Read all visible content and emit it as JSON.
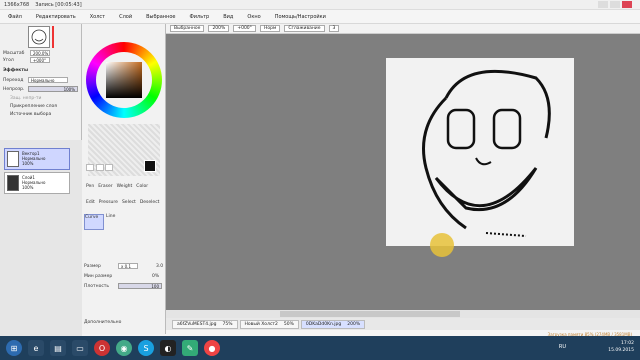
{
  "titlebar": {
    "resolution": "1366x768",
    "recording": "Запись [00:05:43]"
  },
  "menu": [
    "Файл",
    "Редактировать",
    "Холст",
    "Слой",
    "Выбранное",
    "Фильтр",
    "Вид",
    "Окно",
    "Помощь/Настройки"
  ],
  "navigator": {
    "zoom_label": "Масштаб",
    "zoom_value": "200.0%",
    "angle_label": "Угол",
    "angle_value": "+000°",
    "effects_label": "Эффекты",
    "blend_label": "Переход",
    "blend_value": "Нормально",
    "opacity_label": "Непрозр.",
    "opacity_value": "100%",
    "protect_alpha": "Защ. непр-ти",
    "clip_layer": "Прикрепление слоя",
    "selection_source": "Источник выбора"
  },
  "layers": [
    {
      "name": "Вектор1",
      "mode": "Нормально",
      "opacity": "100%"
    },
    {
      "name": "Слой1",
      "mode": "Нормально",
      "opacity": "100%"
    }
  ],
  "tools": {
    "row1": [
      "Pen",
      "Eraser",
      "Weight",
      "Color"
    ],
    "row2": [
      "Edit",
      "Pressure",
      "Select",
      "Deselect"
    ],
    "row3": [
      "Curve",
      "Line"
    ],
    "size_label": "Размер",
    "size_mult": "x 0.1",
    "size_value": "3.0",
    "min_size_label": "Мин размер",
    "min_size_value": "0%",
    "density_label": "Плотность",
    "density_value": "100",
    "extra_label": "Дополнительно"
  },
  "canvas_toolbar": {
    "selection_label": "Выбранное",
    "zoom": "200%",
    "angle": "+000°",
    "mode": "Норм",
    "smoothing_label": "Сглаживание",
    "smoothing_value": "3"
  },
  "tabs": [
    {
      "name": "a6fZVuMEST4.jpg",
      "zoom": "75%"
    },
    {
      "name": "Новый Холст2",
      "zoom": "50%"
    },
    {
      "name": "0DKaDd0Kn.jpg",
      "zoom": "200%"
    }
  ],
  "status": "Загрузка памяти 85% (274MB / 3581MB)",
  "taskbar": {
    "lang": "RU",
    "time": "17:02",
    "date": "15.09.2015"
  },
  "colors": {
    "taskbar": "#1f3f5c",
    "canvas_bg": "#7f7f7f",
    "highlight": "#e8c23a"
  }
}
